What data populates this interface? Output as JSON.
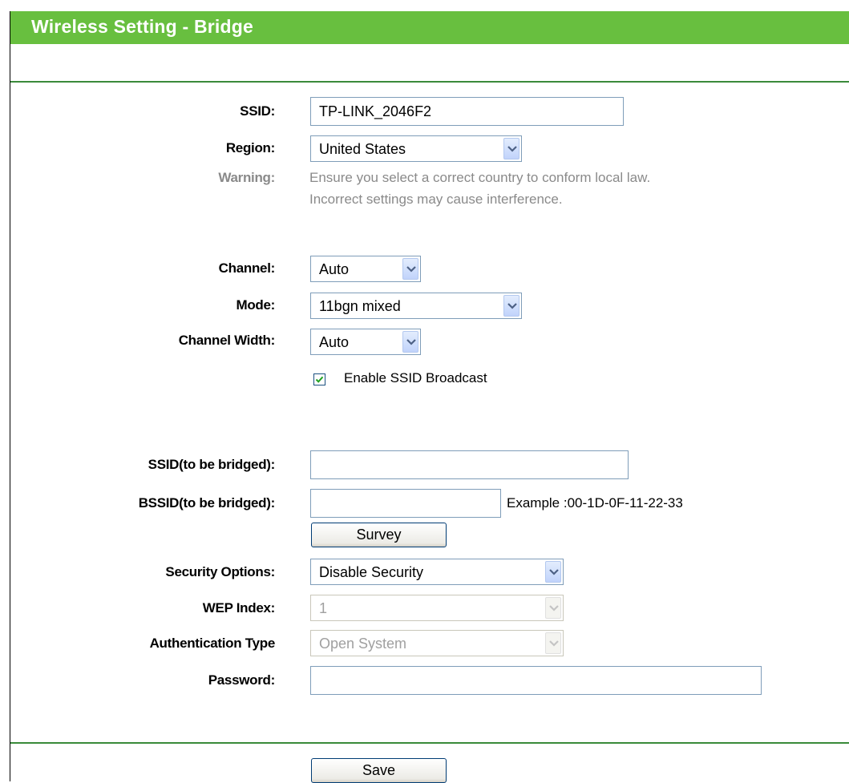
{
  "page": {
    "title": "Wireless Setting - Bridge"
  },
  "form": {
    "ssid": {
      "label": "SSID:",
      "value": "TP-LINK_2046F2"
    },
    "region": {
      "label": "Region:",
      "value": "United States"
    },
    "warning": {
      "label": "Warning:",
      "line1": "Ensure you select a correct country to conform local law.",
      "line2": "Incorrect settings may cause interference."
    },
    "channel": {
      "label": "Channel:",
      "value": "Auto"
    },
    "mode": {
      "label": "Mode:",
      "value": "11bgn mixed"
    },
    "channel_width": {
      "label": "Channel Width:",
      "value": "Auto"
    },
    "ssid_broadcast": {
      "label": "Enable SSID Broadcast",
      "checked": true
    },
    "ssid_bridged": {
      "label": "SSID(to be bridged):",
      "value": ""
    },
    "bssid_bridged": {
      "label": "BSSID(to be bridged):",
      "value": "",
      "example": "Example :00-1D-0F-11-22-33"
    },
    "survey_button": "Survey",
    "security_options": {
      "label": "Security Options:",
      "value": "Disable Security"
    },
    "wep_index": {
      "label": "WEP Index:",
      "value": "1",
      "disabled": true
    },
    "auth_type": {
      "label": "Authentication Type",
      "value": "Open System",
      "disabled": true
    },
    "password": {
      "label": "Password:",
      "value": ""
    },
    "save_button": "Save"
  },
  "colors": {
    "title_bar": "#68bf3f",
    "divider": "#3a8a3a",
    "muted_text": "#8a8a8a"
  },
  "icons": {
    "dropdown": "chevron-down-icon",
    "check": "checkmark-icon"
  }
}
